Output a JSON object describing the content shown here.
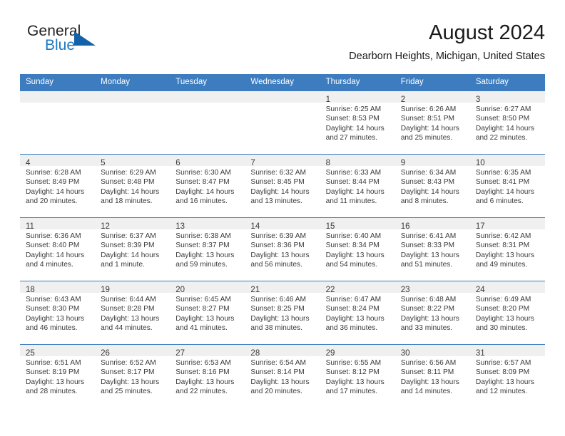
{
  "brand": {
    "name_part1": "General",
    "name_part2": "Blue",
    "logo_icon": "triangle-flag-icon"
  },
  "header": {
    "title": "August 2024",
    "location": "Dearborn Heights, Michigan, United States"
  },
  "colors": {
    "header_blue": "#3c7cbf",
    "brand_blue": "#1b79c2",
    "daynum_band": "#f0f0f0",
    "text": "#3a3a3a"
  },
  "weekday_headers": [
    "Sunday",
    "Monday",
    "Tuesday",
    "Wednesday",
    "Thursday",
    "Friday",
    "Saturday"
  ],
  "labels": {
    "sunrise_prefix": "Sunrise:",
    "sunset_prefix": "Sunset:",
    "daylight_prefix": "Daylight:"
  },
  "weeks": [
    [
      {
        "day": "",
        "lines": []
      },
      {
        "day": "",
        "lines": []
      },
      {
        "day": "",
        "lines": []
      },
      {
        "day": "",
        "lines": []
      },
      {
        "day": "1",
        "lines": [
          "Sunrise: 6:25 AM",
          "Sunset: 8:53 PM",
          "Daylight: 14 hours",
          "and 27 minutes."
        ]
      },
      {
        "day": "2",
        "lines": [
          "Sunrise: 6:26 AM",
          "Sunset: 8:51 PM",
          "Daylight: 14 hours",
          "and 25 minutes."
        ]
      },
      {
        "day": "3",
        "lines": [
          "Sunrise: 6:27 AM",
          "Sunset: 8:50 PM",
          "Daylight: 14 hours",
          "and 22 minutes."
        ]
      }
    ],
    [
      {
        "day": "4",
        "lines": [
          "Sunrise: 6:28 AM",
          "Sunset: 8:49 PM",
          "Daylight: 14 hours",
          "and 20 minutes."
        ]
      },
      {
        "day": "5",
        "lines": [
          "Sunrise: 6:29 AM",
          "Sunset: 8:48 PM",
          "Daylight: 14 hours",
          "and 18 minutes."
        ]
      },
      {
        "day": "6",
        "lines": [
          "Sunrise: 6:30 AM",
          "Sunset: 8:47 PM",
          "Daylight: 14 hours",
          "and 16 minutes."
        ]
      },
      {
        "day": "7",
        "lines": [
          "Sunrise: 6:32 AM",
          "Sunset: 8:45 PM",
          "Daylight: 14 hours",
          "and 13 minutes."
        ]
      },
      {
        "day": "8",
        "lines": [
          "Sunrise: 6:33 AM",
          "Sunset: 8:44 PM",
          "Daylight: 14 hours",
          "and 11 minutes."
        ]
      },
      {
        "day": "9",
        "lines": [
          "Sunrise: 6:34 AM",
          "Sunset: 8:43 PM",
          "Daylight: 14 hours",
          "and 8 minutes."
        ]
      },
      {
        "day": "10",
        "lines": [
          "Sunrise: 6:35 AM",
          "Sunset: 8:41 PM",
          "Daylight: 14 hours",
          "and 6 minutes."
        ]
      }
    ],
    [
      {
        "day": "11",
        "lines": [
          "Sunrise: 6:36 AM",
          "Sunset: 8:40 PM",
          "Daylight: 14 hours",
          "and 4 minutes."
        ]
      },
      {
        "day": "12",
        "lines": [
          "Sunrise: 6:37 AM",
          "Sunset: 8:39 PM",
          "Daylight: 14 hours",
          "and 1 minute."
        ]
      },
      {
        "day": "13",
        "lines": [
          "Sunrise: 6:38 AM",
          "Sunset: 8:37 PM",
          "Daylight: 13 hours",
          "and 59 minutes."
        ]
      },
      {
        "day": "14",
        "lines": [
          "Sunrise: 6:39 AM",
          "Sunset: 8:36 PM",
          "Daylight: 13 hours",
          "and 56 minutes."
        ]
      },
      {
        "day": "15",
        "lines": [
          "Sunrise: 6:40 AM",
          "Sunset: 8:34 PM",
          "Daylight: 13 hours",
          "and 54 minutes."
        ]
      },
      {
        "day": "16",
        "lines": [
          "Sunrise: 6:41 AM",
          "Sunset: 8:33 PM",
          "Daylight: 13 hours",
          "and 51 minutes."
        ]
      },
      {
        "day": "17",
        "lines": [
          "Sunrise: 6:42 AM",
          "Sunset: 8:31 PM",
          "Daylight: 13 hours",
          "and 49 minutes."
        ]
      }
    ],
    [
      {
        "day": "18",
        "lines": [
          "Sunrise: 6:43 AM",
          "Sunset: 8:30 PM",
          "Daylight: 13 hours",
          "and 46 minutes."
        ]
      },
      {
        "day": "19",
        "lines": [
          "Sunrise: 6:44 AM",
          "Sunset: 8:28 PM",
          "Daylight: 13 hours",
          "and 44 minutes."
        ]
      },
      {
        "day": "20",
        "lines": [
          "Sunrise: 6:45 AM",
          "Sunset: 8:27 PM",
          "Daylight: 13 hours",
          "and 41 minutes."
        ]
      },
      {
        "day": "21",
        "lines": [
          "Sunrise: 6:46 AM",
          "Sunset: 8:25 PM",
          "Daylight: 13 hours",
          "and 38 minutes."
        ]
      },
      {
        "day": "22",
        "lines": [
          "Sunrise: 6:47 AM",
          "Sunset: 8:24 PM",
          "Daylight: 13 hours",
          "and 36 minutes."
        ]
      },
      {
        "day": "23",
        "lines": [
          "Sunrise: 6:48 AM",
          "Sunset: 8:22 PM",
          "Daylight: 13 hours",
          "and 33 minutes."
        ]
      },
      {
        "day": "24",
        "lines": [
          "Sunrise: 6:49 AM",
          "Sunset: 8:20 PM",
          "Daylight: 13 hours",
          "and 30 minutes."
        ]
      }
    ],
    [
      {
        "day": "25",
        "lines": [
          "Sunrise: 6:51 AM",
          "Sunset: 8:19 PM",
          "Daylight: 13 hours",
          "and 28 minutes."
        ]
      },
      {
        "day": "26",
        "lines": [
          "Sunrise: 6:52 AM",
          "Sunset: 8:17 PM",
          "Daylight: 13 hours",
          "and 25 minutes."
        ]
      },
      {
        "day": "27",
        "lines": [
          "Sunrise: 6:53 AM",
          "Sunset: 8:16 PM",
          "Daylight: 13 hours",
          "and 22 minutes."
        ]
      },
      {
        "day": "28",
        "lines": [
          "Sunrise: 6:54 AM",
          "Sunset: 8:14 PM",
          "Daylight: 13 hours",
          "and 20 minutes."
        ]
      },
      {
        "day": "29",
        "lines": [
          "Sunrise: 6:55 AM",
          "Sunset: 8:12 PM",
          "Daylight: 13 hours",
          "and 17 minutes."
        ]
      },
      {
        "day": "30",
        "lines": [
          "Sunrise: 6:56 AM",
          "Sunset: 8:11 PM",
          "Daylight: 13 hours",
          "and 14 minutes."
        ]
      },
      {
        "day": "31",
        "lines": [
          "Sunrise: 6:57 AM",
          "Sunset: 8:09 PM",
          "Daylight: 13 hours",
          "and 12 minutes."
        ]
      }
    ]
  ]
}
